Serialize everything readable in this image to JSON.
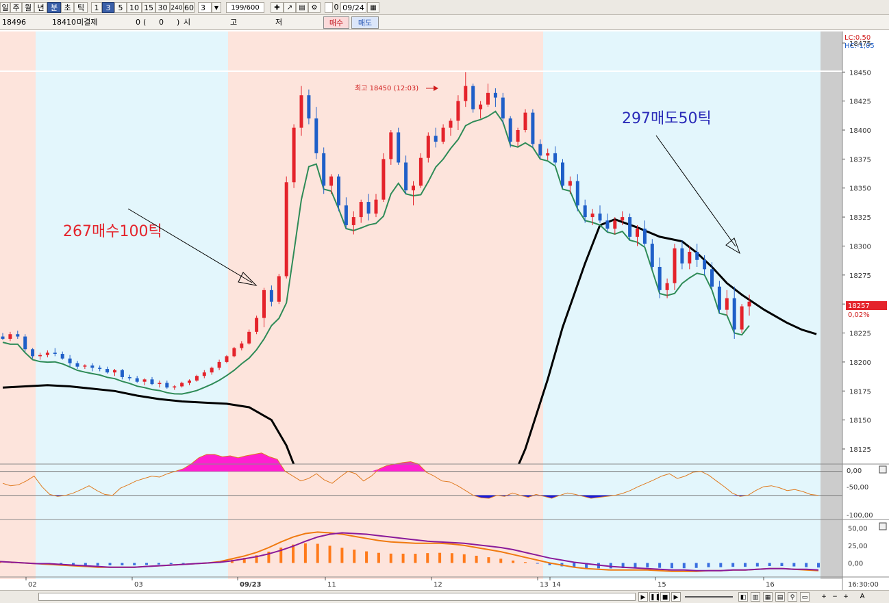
{
  "toolbar": {
    "periods": [
      "일",
      "주",
      "월",
      "년",
      "분",
      "초",
      "틱"
    ],
    "intervals": [
      "1",
      "3",
      "5",
      "10",
      "15",
      "30",
      "240",
      "60"
    ],
    "interval_input": "3",
    "count": "199/600",
    "checkbox_label": "0",
    "date": "09/24"
  },
  "quote": {
    "price1": "18496",
    "price2": "18410",
    "unfilled_label": "미결제",
    "unfilled_value": "0",
    "paren_open": "(",
    "paren_value": "0",
    "paren_close": ")",
    "open_label": "시",
    "high_label": "고",
    "low_label": "저",
    "buy_label": "매수",
    "sell_label": "매도"
  },
  "annotations": {
    "buy_note": "267매수100틱",
    "sell_note": "297매도50틱",
    "high_marker": "최고 18450 (12:03)"
  },
  "price_axis": {
    "ticks": [
      "18475",
      "18450",
      "18425",
      "18400",
      "18375",
      "18350",
      "18325",
      "18300",
      "18275",
      "18250",
      "18225",
      "18200",
      "18175",
      "18150",
      "18125"
    ],
    "lc_label": "LC:0,50",
    "hc_label": "HC:-1,05",
    "current_price": "18257",
    "current_change": "0,02%"
  },
  "osc_axis": {
    "ticks": [
      "0,00",
      "-50,00",
      "-100,00"
    ]
  },
  "macd_axis": {
    "ticks": [
      "50,00",
      "25,00",
      "0,00"
    ]
  },
  "time_axis": {
    "labels": [
      "02",
      "03",
      "09/23",
      "11",
      "12",
      "13",
      "14",
      "15",
      "16"
    ],
    "right_time": "16:30:00"
  },
  "colors": {
    "up": "#e4232b",
    "down": "#1f5fc8",
    "pink_bg": "#fde4dc",
    "blue_bg": "#e3f6fc",
    "signal": "#2e8b57",
    "ma": "#000000"
  },
  "chart_data": {
    "type": "candlestick",
    "ylim": [
      18112,
      18485
    ],
    "ohlc": [
      [
        18222,
        18225,
        18219,
        18220
      ],
      [
        18220,
        18226,
        18218,
        18224
      ],
      [
        18224,
        18227,
        18220,
        18222
      ],
      [
        18222,
        18224,
        18209,
        18211
      ],
      [
        18211,
        18212,
        18203,
        18205
      ],
      [
        18205,
        18208,
        18202,
        18206
      ],
      [
        18206,
        18210,
        18204,
        18208
      ],
      [
        18208,
        18212,
        18205,
        18207
      ],
      [
        18207,
        18209,
        18202,
        18203
      ],
      [
        18203,
        18206,
        18196,
        18199
      ],
      [
        18199,
        18201,
        18194,
        18196
      ],
      [
        18196,
        18198,
        18194,
        18197
      ],
      [
        18197,
        18199,
        18192,
        18195
      ],
      [
        18195,
        18197,
        18192,
        18194
      ],
      [
        18194,
        18196,
        18190,
        18191
      ],
      [
        18191,
        18194,
        18188,
        18193
      ],
      [
        18193,
        18194,
        18185,
        18187
      ],
      [
        18187,
        18189,
        18184,
        18186
      ],
      [
        18186,
        18188,
        18182,
        18183
      ],
      [
        18183,
        18186,
        18180,
        18185
      ],
      [
        18185,
        18187,
        18180,
        18181
      ],
      [
        18181,
        18184,
        18178,
        18182
      ],
      [
        18182,
        18184,
        18177,
        18178
      ],
      [
        18178,
        18180,
        18176,
        18179
      ],
      [
        18179,
        18183,
        18178,
        18182
      ],
      [
        18182,
        18185,
        18180,
        18184
      ],
      [
        18184,
        18189,
        18183,
        18188
      ],
      [
        18188,
        18193,
        18186,
        18191
      ],
      [
        18191,
        18196,
        18189,
        18195
      ],
      [
        18195,
        18202,
        18193,
        18200
      ],
      [
        18200,
        18206,
        18199,
        18205
      ],
      [
        18205,
        18213,
        18204,
        18212
      ],
      [
        18212,
        18218,
        18210,
        18216
      ],
      [
        18216,
        18228,
        18215,
        18226
      ],
      [
        18226,
        18240,
        18224,
        18238
      ],
      [
        18238,
        18264,
        18230,
        18262
      ],
      [
        18262,
        18266,
        18248,
        18252
      ],
      [
        18252,
        18276,
        18250,
        18274
      ],
      [
        18274,
        18360,
        18272,
        18355
      ],
      [
        18355,
        18405,
        18350,
        18402
      ],
      [
        18402,
        18438,
        18395,
        18430
      ],
      [
        18430,
        18435,
        18405,
        18410
      ],
      [
        18410,
        18420,
        18375,
        18380
      ],
      [
        18380,
        18385,
        18345,
        18352
      ],
      [
        18352,
        18362,
        18345,
        18360
      ],
      [
        18360,
        18362,
        18330,
        18335
      ],
      [
        18335,
        18342,
        18315,
        18318
      ],
      [
        18318,
        18330,
        18310,
        18325
      ],
      [
        18325,
        18340,
        18320,
        18338
      ],
      [
        18338,
        18345,
        18322,
        18328
      ],
      [
        18328,
        18345,
        18325,
        18340
      ],
      [
        18340,
        18380,
        18338,
        18375
      ],
      [
        18375,
        18400,
        18370,
        18398
      ],
      [
        18398,
        18402,
        18370,
        18372
      ],
      [
        18372,
        18378,
        18345,
        18348
      ],
      [
        18348,
        18356,
        18335,
        18352
      ],
      [
        18352,
        18380,
        18350,
        18376
      ],
      [
        18376,
        18398,
        18372,
        18395
      ],
      [
        18395,
        18402,
        18385,
        18390
      ],
      [
        18390,
        18405,
        18388,
        18402
      ],
      [
        18402,
        18410,
        18395,
        18408
      ],
      [
        18408,
        18430,
        18400,
        18425
      ],
      [
        18425,
        18450,
        18420,
        18438
      ],
      [
        18438,
        18440,
        18415,
        18418
      ],
      [
        18418,
        18425,
        18410,
        18422
      ],
      [
        18422,
        18440,
        18420,
        18432
      ],
      [
        18432,
        18436,
        18420,
        18428
      ],
      [
        18428,
        18432,
        18405,
        18410
      ],
      [
        18410,
        18412,
        18385,
        18390
      ],
      [
        18390,
        18402,
        18386,
        18400
      ],
      [
        18400,
        18418,
        18398,
        18415
      ],
      [
        18415,
        18418,
        18385,
        18388
      ],
      [
        18388,
        18392,
        18375,
        18378
      ],
      [
        18378,
        18384,
        18374,
        18380
      ],
      [
        18380,
        18386,
        18370,
        18372
      ],
      [
        18372,
        18375,
        18350,
        18352
      ],
      [
        18352,
        18360,
        18345,
        18356
      ],
      [
        18356,
        18362,
        18330,
        18335
      ],
      [
        18335,
        18340,
        18320,
        18325
      ],
      [
        18325,
        18332,
        18318,
        18328
      ],
      [
        18328,
        18335,
        18320,
        18322
      ],
      [
        18322,
        18328,
        18312,
        18315
      ],
      [
        18315,
        18325,
        18310,
        18322
      ],
      [
        18322,
        18330,
        18318,
        18325
      ],
      [
        18325,
        18328,
        18305,
        18308
      ],
      [
        18308,
        18318,
        18300,
        18315
      ],
      [
        18315,
        18322,
        18300,
        18302
      ],
      [
        18302,
        18306,
        18280,
        18282
      ],
      [
        18282,
        18290,
        18255,
        18262
      ],
      [
        18262,
        18272,
        18255,
        18268
      ],
      [
        18268,
        18302,
        18262,
        18298
      ],
      [
        18298,
        18305,
        18280,
        18285
      ],
      [
        18285,
        18300,
        18280,
        18295
      ],
      [
        18295,
        18302,
        18282,
        18288
      ],
      [
        18288,
        18292,
        18275,
        18280
      ],
      [
        18280,
        18286,
        18262,
        18265
      ],
      [
        18265,
        18270,
        18242,
        18245
      ],
      [
        18245,
        18262,
        18240,
        18255
      ],
      [
        18255,
        18265,
        18220,
        18228
      ],
      [
        18228,
        18250,
        18225,
        18248
      ],
      [
        18248,
        18258,
        18240,
        18252
      ]
    ],
    "ma": [
      [
        0,
        18178
      ],
      [
        3,
        18179
      ],
      [
        6,
        18180
      ],
      [
        9,
        18179
      ],
      [
        12,
        18177
      ],
      [
        15,
        18175
      ],
      [
        18,
        18171
      ],
      [
        21,
        18168
      ],
      [
        24,
        18166
      ],
      [
        27,
        18165
      ],
      [
        30,
        18164
      ],
      [
        33,
        18161
      ],
      [
        36,
        18150
      ],
      [
        38,
        18128
      ],
      [
        40,
        18095
      ],
      [
        45,
        18030
      ],
      [
        55,
        17980
      ],
      [
        62,
        18015
      ],
      [
        66,
        18065
      ],
      [
        70,
        18125
      ],
      [
        73,
        18185
      ],
      [
        75,
        18230
      ],
      [
        78,
        18285
      ],
      [
        80,
        18318
      ],
      [
        82,
        18323
      ],
      [
        85,
        18316
      ],
      [
        88,
        18308
      ],
      [
        91,
        18304
      ],
      [
        93,
        18294
      ],
      [
        95,
        18282
      ],
      [
        97,
        18268
      ],
      [
        99,
        18258
      ],
      [
        102,
        18245
      ],
      [
        105,
        18234
      ],
      [
        107,
        18228
      ],
      [
        109,
        18224
      ]
    ],
    "osc": [
      -35,
      -40,
      -38,
      -30,
      -20,
      -42,
      -58,
      -62,
      -60,
      -55,
      -48,
      -40,
      -50,
      -58,
      -60,
      -45,
      -38,
      -30,
      -25,
      -20,
      -22,
      -15,
      -10,
      -5,
      5,
      18,
      25,
      25,
      20,
      22,
      18,
      22,
      25,
      28,
      20,
      15,
      -10,
      -20,
      -30,
      -25,
      -15,
      -28,
      -35,
      -22,
      -10,
      -15,
      -30,
      -20,
      -5,
      2,
      5,
      8,
      10,
      5,
      -12,
      -20,
      -30,
      -32,
      -40,
      -50,
      -60,
      -65,
      -66,
      -60,
      -62,
      -55,
      -60,
      -64,
      -58,
      -62,
      -66,
      -60,
      -55,
      -58,
      -62,
      -66,
      -64,
      -62,
      -60,
      -56,
      -50,
      -42,
      -35,
      -28,
      -20,
      -15,
      -25,
      -20,
      -12,
      -10,
      -18,
      -30,
      -42,
      -55,
      -62,
      -60,
      -50,
      -42,
      -40,
      -44,
      -50,
      -48,
      -52,
      -58,
      -60
    ],
    "macd": [
      [
        2,
        2
      ],
      [
        1,
        1
      ],
      [
        0,
        0
      ],
      [
        -1,
        -1
      ],
      [
        -2,
        -1
      ],
      [
        -3,
        -2
      ],
      [
        -4,
        -3
      ],
      [
        -5,
        -4
      ],
      [
        -6,
        -5
      ],
      [
        -6,
        -6
      ],
      [
        -6,
        -6
      ],
      [
        -6,
        -6
      ],
      [
        -5,
        -5
      ],
      [
        -4,
        -4
      ],
      [
        -3,
        -3
      ],
      [
        -2,
        -2
      ],
      [
        -1,
        -1
      ],
      [
        0,
        0
      ],
      [
        2,
        1
      ],
      [
        6,
        3
      ],
      [
        10,
        6
      ],
      [
        15,
        9
      ],
      [
        22,
        13
      ],
      [
        30,
        18
      ],
      [
        37,
        24
      ],
      [
        42,
        31
      ],
      [
        44,
        37
      ],
      [
        43,
        41
      ],
      [
        41,
        43
      ],
      [
        38,
        42
      ],
      [
        35,
        41
      ],
      [
        32,
        39
      ],
      [
        30,
        37
      ],
      [
        29,
        35
      ],
      [
        28,
        33
      ],
      [
        28,
        31
      ],
      [
        28,
        30
      ],
      [
        27,
        29
      ],
      [
        25,
        28
      ],
      [
        22,
        26
      ],
      [
        19,
        24
      ],
      [
        16,
        22
      ],
      [
        12,
        19
      ],
      [
        8,
        15
      ],
      [
        4,
        11
      ],
      [
        0,
        7
      ],
      [
        -3,
        4
      ],
      [
        -6,
        1
      ],
      [
        -8,
        -1
      ],
      [
        -9,
        -3
      ],
      [
        -10,
        -5
      ],
      [
        -10,
        -6
      ],
      [
        -10,
        -7
      ],
      [
        -10,
        -8
      ],
      [
        -11,
        -9
      ],
      [
        -12,
        -10
      ],
      [
        -12,
        -10
      ],
      [
        -12,
        -11
      ],
      [
        -11,
        -11
      ],
      [
        -11,
        -11
      ],
      [
        -10,
        -10
      ],
      [
        -10,
        -10
      ],
      [
        -9,
        -9
      ],
      [
        -8,
        -8
      ],
      [
        -8,
        -8
      ],
      [
        -9,
        -9
      ],
      [
        -10,
        -9
      ],
      [
        -11,
        -10
      ]
    ]
  }
}
